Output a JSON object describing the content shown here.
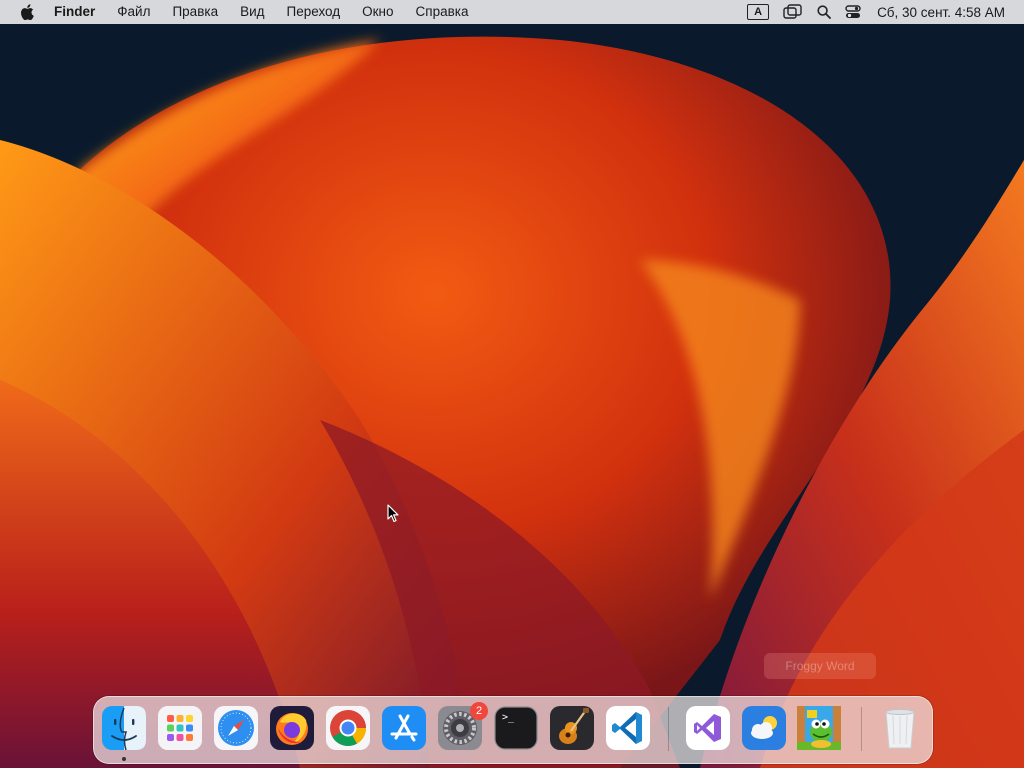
{
  "menubar": {
    "apple_icon": "apple-logo-icon",
    "app_name": "Finder",
    "menus": [
      "Файл",
      "Правка",
      "Вид",
      "Переход",
      "Окно",
      "Справка"
    ],
    "input_source": "A",
    "status_icons": [
      "screen-mirroring-icon",
      "spotlight-search-icon",
      "control-center-icon"
    ],
    "clock": "Сб, 30 сент.  4:58 AM"
  },
  "tooltip": {
    "text": "Froggy Word"
  },
  "dock": {
    "apps": [
      {
        "name": "Finder",
        "icon": "finder-icon",
        "running": true
      },
      {
        "name": "Launchpad",
        "icon": "launchpad-icon"
      },
      {
        "name": "Safari",
        "icon": "safari-icon"
      },
      {
        "name": "Firefox",
        "icon": "firefox-icon"
      },
      {
        "name": "Chrome",
        "icon": "chrome-icon"
      },
      {
        "name": "App Store",
        "icon": "app-store-icon"
      },
      {
        "name": "System Settings",
        "icon": "system-settings-icon",
        "badge": "2"
      },
      {
        "name": "Terminal",
        "icon": "terminal-icon"
      },
      {
        "name": "GarageBand",
        "icon": "garageband-icon"
      },
      {
        "name": "Visual Studio Code",
        "icon": "vscode-icon"
      },
      {
        "name": "Visual Studio",
        "icon": "visual-studio-icon"
      },
      {
        "name": "Weather",
        "icon": "weather-icon"
      },
      {
        "name": "Froggy Word",
        "icon": "froggy-game-icon"
      },
      {
        "name": "Trash",
        "icon": "trash-icon"
      }
    ],
    "terminal_prompt": ">_"
  },
  "colors": {
    "menubar_bg": "#e8e8ec",
    "badge": "#f0463c",
    "wallpaper_orange": "#f07a1a",
    "wallpaper_dark": "#0a1a2c"
  }
}
